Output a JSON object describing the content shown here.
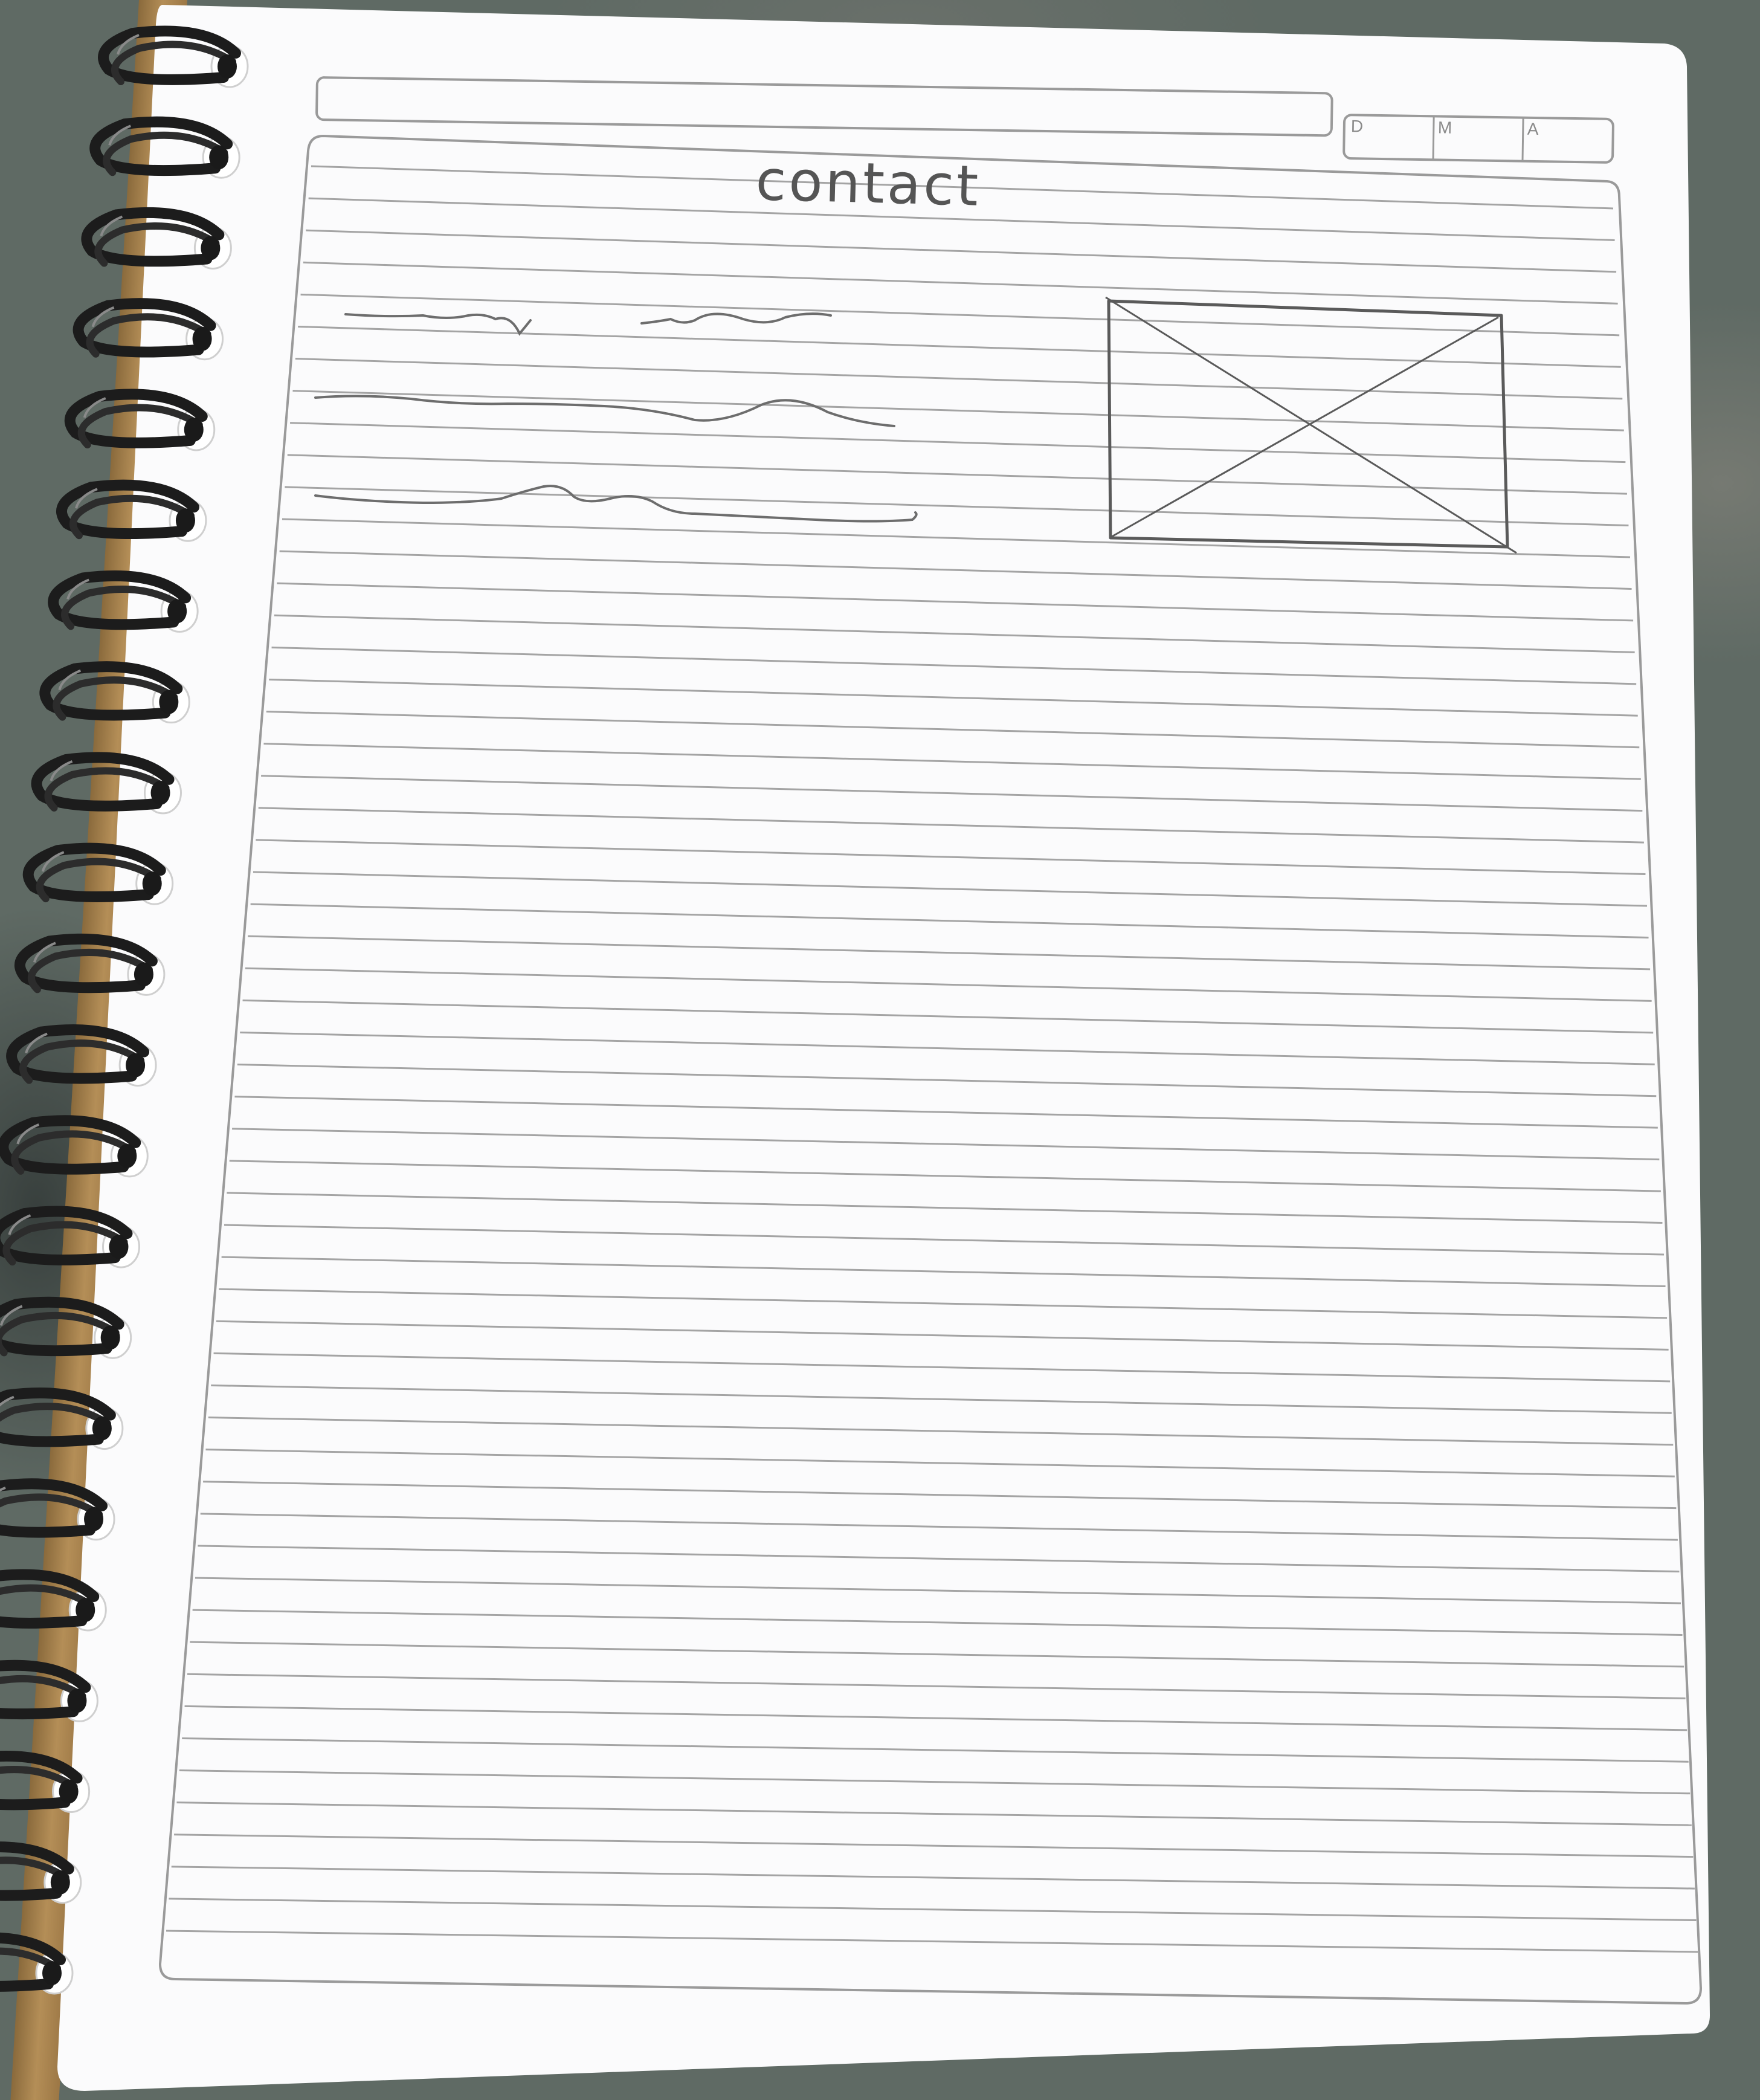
{
  "sketch": {
    "heading": "contact",
    "header_fields": [
      "D",
      "M",
      "A"
    ]
  },
  "colors": {
    "paper": "#fbfbfc",
    "ruling": "#9a9a9a",
    "pencil": "#5a5a5a",
    "spiral": "#1c1c1c"
  },
  "icons": [
    "image-placeholder-icon",
    "spiral-binding-icon"
  ]
}
